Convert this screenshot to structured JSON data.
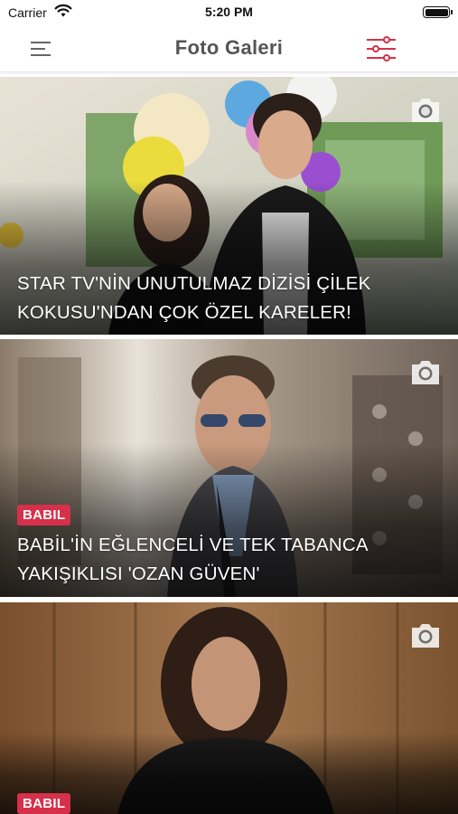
{
  "status_bar": {
    "carrier": "Carrier",
    "time": "5:20 PM"
  },
  "nav": {
    "title": "Foto Galeri",
    "menu_icon": "hamburger-menu-icon",
    "filter_icon": "sliders-filter-icon",
    "accent_color": "#d6304a"
  },
  "cards": [
    {
      "badge": "",
      "headline_line1": "STAR TV'NİN UNUTULMAZ DİZİSİ ÇİLEK",
      "headline_line2": "KOKUSU'NDAN ÇOK ÖZEL KARELER!",
      "icon": "camera-icon"
    },
    {
      "badge": "BABIL",
      "headline_line1": "BABİL'İN EĞLENCELİ VE TEK TABANCA",
      "headline_line2": "YAKIŞIKLISI 'OZAN GÜVEN'",
      "icon": "camera-icon"
    },
    {
      "badge": "BABIL",
      "headline_line1": "",
      "headline_line2": "",
      "icon": "camera-icon"
    }
  ],
  "colors": {
    "badge_bg": "#d6304a",
    "title_text": "#555555"
  }
}
